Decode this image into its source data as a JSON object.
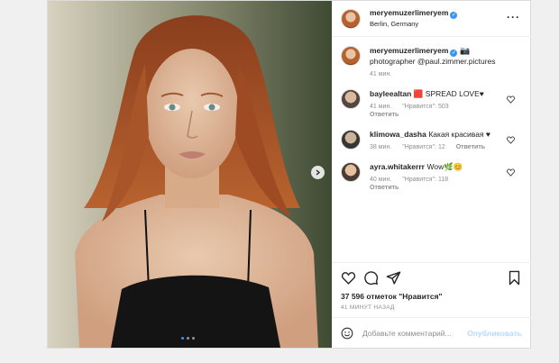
{
  "post": {
    "author": "meryemuzerlimeryem",
    "location": "Berlin, Germany",
    "caption_text": "photographer @paul.zimmer.pictures",
    "caption_time": "41 мин.",
    "likes": "37 596 отметок \"Нравится\"",
    "posted_ago": "41 МИНУТ НАЗАД",
    "carousel_slide": 1,
    "carousel_total": 3
  },
  "comments": [
    {
      "user": "bayleealtan",
      "text": "🟥 SPREAD LOVE♥",
      "age": "41 мин.",
      "likes": "\"Нравится\": 503",
      "reply": "Ответить"
    },
    {
      "user": "klimowa_dasha",
      "text": "Какая красивая ♥",
      "age": "38 мин.",
      "likes": "\"Нравится\": 12",
      "reply": "Ответить"
    },
    {
      "user": "ayra.whitakerrr",
      "text": "Wow🌿😊",
      "age": "40 мин.",
      "likes": "\"Нравится\": 118",
      "reply": "Ответить"
    }
  ],
  "add_comment": {
    "placeholder": "Добавьте комментарий...",
    "publish_label": "Опубликовать"
  },
  "icons": {
    "like": "heart-icon",
    "comment": "comment-icon",
    "share": "share-icon",
    "save": "bookmark-icon",
    "emoji": "emoji-icon",
    "more": "more-icon",
    "next": "chevron-right-icon"
  },
  "colors": {
    "verified": "#3897f0",
    "muted": "#8e8e8e",
    "publish_disabled": "#b3dbff"
  }
}
